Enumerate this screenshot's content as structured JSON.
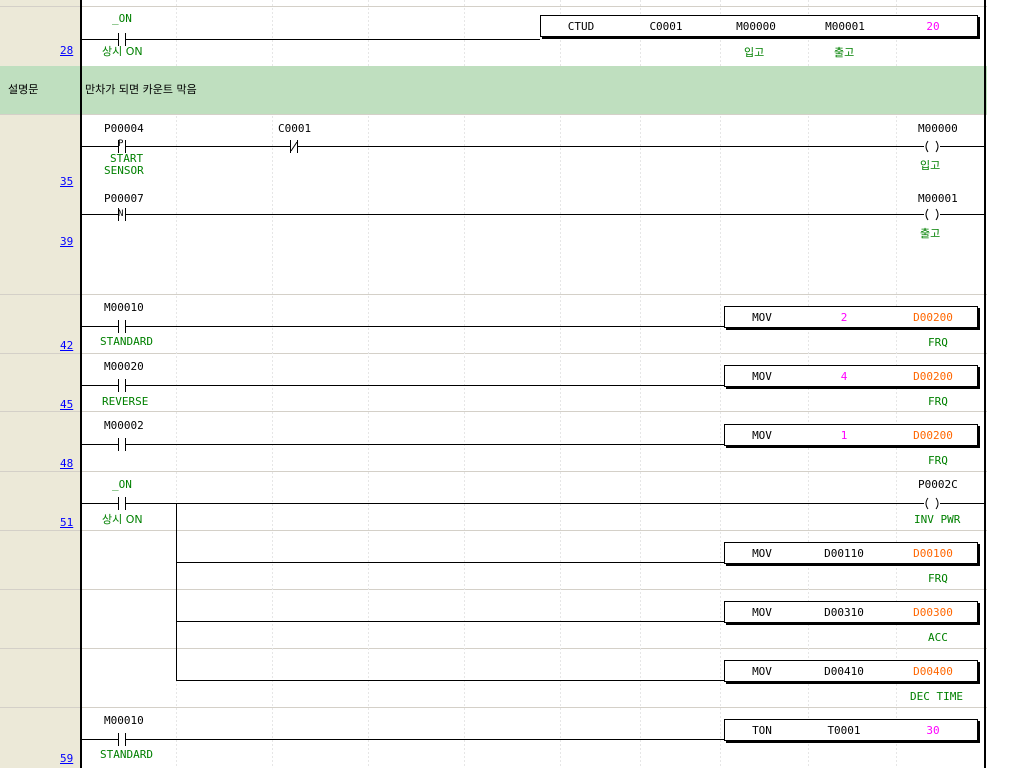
{
  "rungs": [
    {
      "step": "28"
    },
    {
      "step": "35"
    },
    {
      "step": "39"
    },
    {
      "step": "42"
    },
    {
      "step": "45"
    },
    {
      "step": "48"
    },
    {
      "step": "51"
    },
    {
      "step": "59"
    }
  ],
  "comment": {
    "row_label": "설명문",
    "text": "만차가 되면 카운트 막음"
  },
  "contacts": {
    "on1": {
      "addr": "_ON",
      "desc": "상시 ON"
    },
    "p4": {
      "addr": "P00004",
      "sym": "P",
      "desc1": "START",
      "desc2": "SENSOR"
    },
    "c1": {
      "addr": "C0001",
      "sym": "/"
    },
    "p7": {
      "addr": "P00007",
      "sym": "N"
    },
    "m10a": {
      "addr": "M00010",
      "desc": "STANDARD"
    },
    "m20": {
      "addr": "M00020",
      "desc": "REVERSE"
    },
    "m2": {
      "addr": "M00002"
    },
    "on2": {
      "addr": "_ON",
      "desc": "상시 ON"
    },
    "m10b": {
      "addr": "M00010",
      "desc": "STANDARD"
    }
  },
  "coils": {
    "m0": {
      "addr": "M00000",
      "desc": "입고"
    },
    "m1": {
      "addr": "M00001",
      "desc": "출고"
    },
    "pwr": {
      "addr": "P0002C",
      "desc": "INV PWR"
    }
  },
  "ctud": {
    "op": "CTUD",
    "counter": "C0001",
    "up": "M00000",
    "down": "M00001",
    "preset": "20",
    "up_desc": "입고",
    "down_desc": "출고"
  },
  "movs": [
    {
      "op": "MOV",
      "src": "2",
      "dst": "D00200",
      "desc": "FRQ"
    },
    {
      "op": "MOV",
      "src": "4",
      "dst": "D00200",
      "desc": "FRQ"
    },
    {
      "op": "MOV",
      "src": "1",
      "dst": "D00200",
      "desc": "FRQ"
    },
    {
      "op": "MOV",
      "src": "D00110",
      "dst": "D00100",
      "desc": "FRQ"
    },
    {
      "op": "MOV",
      "src": "D00310",
      "dst": "D00300",
      "desc": "ACC"
    },
    {
      "op": "MOV",
      "src": "D00410",
      "dst": "D00400",
      "desc": "DEC TIME"
    }
  ],
  "ton": {
    "op": "TON",
    "timer": "T0001",
    "preset": "30"
  },
  "colors": {
    "gutter": "#ece9d8",
    "comment_bg": "#bfdfbf",
    "desc": "#008000",
    "step": "#0000ff",
    "preset": "#ff00ff",
    "dst": "#ff6600"
  }
}
